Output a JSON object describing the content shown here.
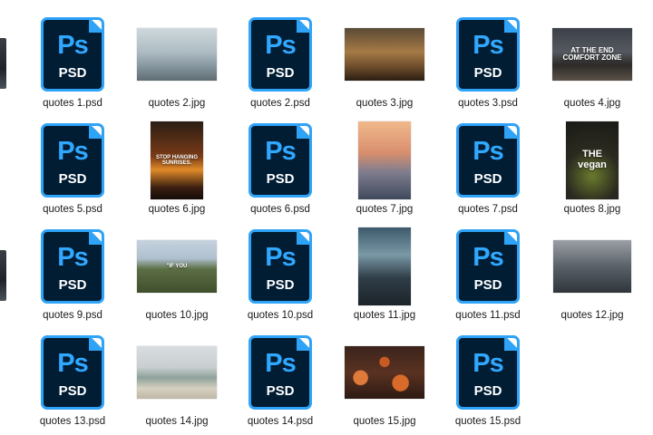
{
  "files": [
    {
      "name": "quotes 1.psd",
      "type": "psd",
      "icon": "photoshop-file-icon",
      "logo": "Ps",
      "ext": "PSD"
    },
    {
      "name": "quotes 2.jpg",
      "type": "jpg",
      "icon": "image-thumbnail",
      "caption": "",
      "theme": "t-q2",
      "shape": "landscape"
    },
    {
      "name": "quotes 2.psd",
      "type": "psd",
      "icon": "photoshop-file-icon",
      "logo": "Ps",
      "ext": "PSD"
    },
    {
      "name": "quotes 3.jpg",
      "type": "jpg",
      "icon": "image-thumbnail",
      "caption": "",
      "theme": "t-q3",
      "shape": "landscape"
    },
    {
      "name": "quotes 3.psd",
      "type": "psd",
      "icon": "photoshop-file-icon",
      "logo": "Ps",
      "ext": "PSD"
    },
    {
      "name": "quotes 4.jpg",
      "type": "jpg",
      "icon": "image-thumbnail",
      "caption": "AT THE END COMFORT ZONE",
      "theme": "t-q4",
      "shape": "landscape"
    },
    {
      "name": "quotes 5.psd",
      "type": "psd",
      "icon": "photoshop-file-icon",
      "logo": "Ps",
      "ext": "PSD"
    },
    {
      "name": "quotes 6.jpg",
      "type": "jpg",
      "icon": "image-thumbnail",
      "caption": "STOP HANGING SUNRISES.",
      "theme": "t-q6",
      "shape": "portrait"
    },
    {
      "name": "quotes 6.psd",
      "type": "psd",
      "icon": "photoshop-file-icon",
      "logo": "Ps",
      "ext": "PSD"
    },
    {
      "name": "quotes 7.jpg",
      "type": "jpg",
      "icon": "image-thumbnail",
      "caption": "",
      "theme": "t-q7",
      "shape": "portrait"
    },
    {
      "name": "quotes 7.psd",
      "type": "psd",
      "icon": "photoshop-file-icon",
      "logo": "Ps",
      "ext": "PSD"
    },
    {
      "name": "quotes 8.jpg",
      "type": "jpg",
      "icon": "image-thumbnail",
      "caption": "THE vegan",
      "theme": "t-q8",
      "shape": "portrait"
    },
    {
      "name": "quotes 9.psd",
      "type": "psd",
      "icon": "photoshop-file-icon",
      "logo": "Ps",
      "ext": "PSD"
    },
    {
      "name": "quotes 10.jpg",
      "type": "jpg",
      "icon": "image-thumbnail",
      "caption": "\"IF YOU",
      "theme": "t-q10",
      "shape": "landscape"
    },
    {
      "name": "quotes 10.psd",
      "type": "psd",
      "icon": "photoshop-file-icon",
      "logo": "Ps",
      "ext": "PSD"
    },
    {
      "name": "quotes 11.jpg",
      "type": "jpg",
      "icon": "image-thumbnail",
      "caption": "",
      "theme": "t-q11",
      "shape": "portrait"
    },
    {
      "name": "quotes 11.psd",
      "type": "psd",
      "icon": "photoshop-file-icon",
      "logo": "Ps",
      "ext": "PSD"
    },
    {
      "name": "quotes 12.jpg",
      "type": "jpg",
      "icon": "image-thumbnail",
      "caption": "",
      "theme": "t-q12",
      "shape": "wide"
    },
    {
      "name": "quotes 13.psd",
      "type": "psd",
      "icon": "photoshop-file-icon",
      "logo": "Ps",
      "ext": "PSD"
    },
    {
      "name": "quotes 14.jpg",
      "type": "jpg",
      "icon": "image-thumbnail",
      "caption": "",
      "theme": "t-q14",
      "shape": "landscape"
    },
    {
      "name": "quotes 14.psd",
      "type": "psd",
      "icon": "photoshop-file-icon",
      "logo": "Ps",
      "ext": "PSD"
    },
    {
      "name": "quotes 15.jpg",
      "type": "jpg",
      "icon": "image-thumbnail",
      "caption": "",
      "theme": "t-q15",
      "shape": "landscape"
    },
    {
      "name": "quotes 15.psd",
      "type": "psd",
      "icon": "photoshop-file-icon",
      "logo": "Ps",
      "ext": "PSD"
    }
  ],
  "colors": {
    "psd_background": "#001d34",
    "psd_accent": "#31a8ff"
  }
}
